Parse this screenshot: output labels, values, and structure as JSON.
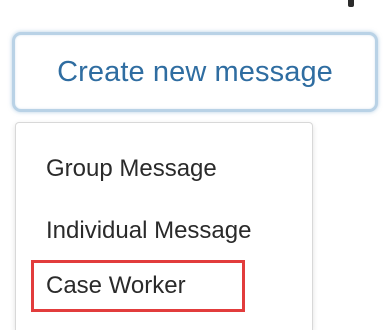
{
  "header": {
    "create_button_label": "Create new message"
  },
  "dropdown": {
    "items": [
      {
        "label": "Group Message"
      },
      {
        "label": "Individual Message"
      },
      {
        "label": "Case Worker",
        "highlighted": true
      }
    ],
    "highlight_color": "#e23c3c"
  },
  "colors": {
    "button_text": "#2f6da1",
    "button_border": "#b9d2e6",
    "menu_text": "#2a2a2a"
  }
}
